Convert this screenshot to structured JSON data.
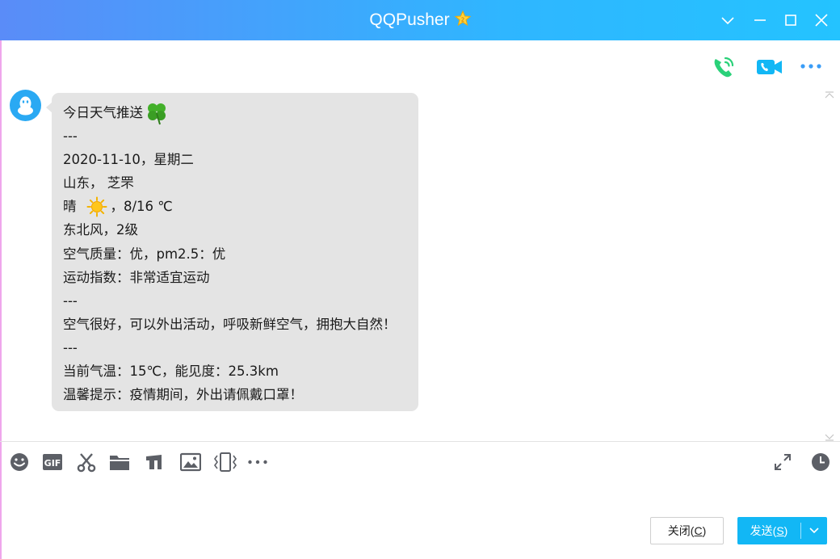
{
  "window": {
    "title": "QQPusher"
  },
  "message": {
    "lines": [
      "今日天气推送",
      "---",
      "2020-11-10，星期二",
      "山东， 芝罘",
      "晴",
      "，8/16 ℃",
      "东北风，2级",
      "空气质量：优，pm2.5：优",
      "运动指数：非常适宜运动",
      "---",
      "空气很好，可以外出活动，呼吸新鲜空气，拥抱大自然！",
      "---",
      "当前气温：15℃，能见度：25.3km",
      "温馨提示：疫情期间，外出请佩戴口罩！"
    ]
  },
  "buttons": {
    "close_label": "关闭(",
    "close_key": "C",
    "close_end": ")",
    "send_label": "发送(",
    "send_key": "S",
    "send_end": ")"
  },
  "colors": {
    "accent": "#12b7f5",
    "bubble": "#e4e4e4",
    "call_green": "#2ad179"
  }
}
